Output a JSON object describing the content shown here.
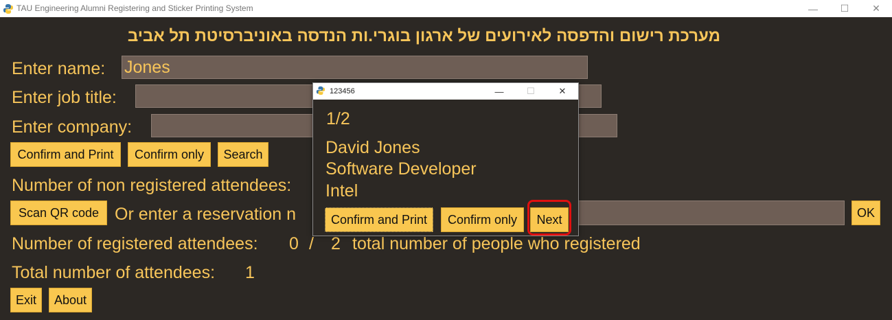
{
  "window": {
    "title": "TAU Engineering Alumni Registering and Sticker Printing System",
    "minimize": "—",
    "maximize": "☐",
    "close": "✕"
  },
  "main": {
    "hebrew_title": "מערכת רישום והדפסה לאירועים של ארגון בוגרי.ות הנדסה באוניברסיטת תל אביב",
    "name_label": "Enter name:",
    "name_value": "Jones",
    "job_label": "Enter job title:",
    "job_value": "",
    "company_label": "Enter company:",
    "company_value": "",
    "btn_confirm_print": "Confirm and Print",
    "btn_confirm_only": "Confirm only",
    "btn_search": "Search",
    "non_registered_label": "Number of non registered attendees:",
    "btn_scan_qr": "Scan QR code",
    "reservation_label": "Or enter a reservation n",
    "reservation_value": "",
    "btn_ok": "OK",
    "registered_label": "Number of registered attendees:",
    "registered_count": "0",
    "registered_sep": "/",
    "registered_total": "2",
    "registered_suffix": "total number of people who registered",
    "total_label": "Total number of attendees:",
    "total_value": "1",
    "btn_exit": "Exit",
    "btn_about": "About"
  },
  "dialog": {
    "title": "123456",
    "counter": "1/2",
    "person_name": "David Jones",
    "person_job": "Software Developer",
    "person_company": "Intel",
    "btn_confirm_print": "Confirm and Print",
    "btn_confirm_only": "Confirm only",
    "btn_next": "Next"
  },
  "colors": {
    "background": "#2c2824",
    "accent_text": "#f7c55a",
    "button": "#f9c74f",
    "input": "#6e5e55",
    "highlight": "#e01010"
  }
}
